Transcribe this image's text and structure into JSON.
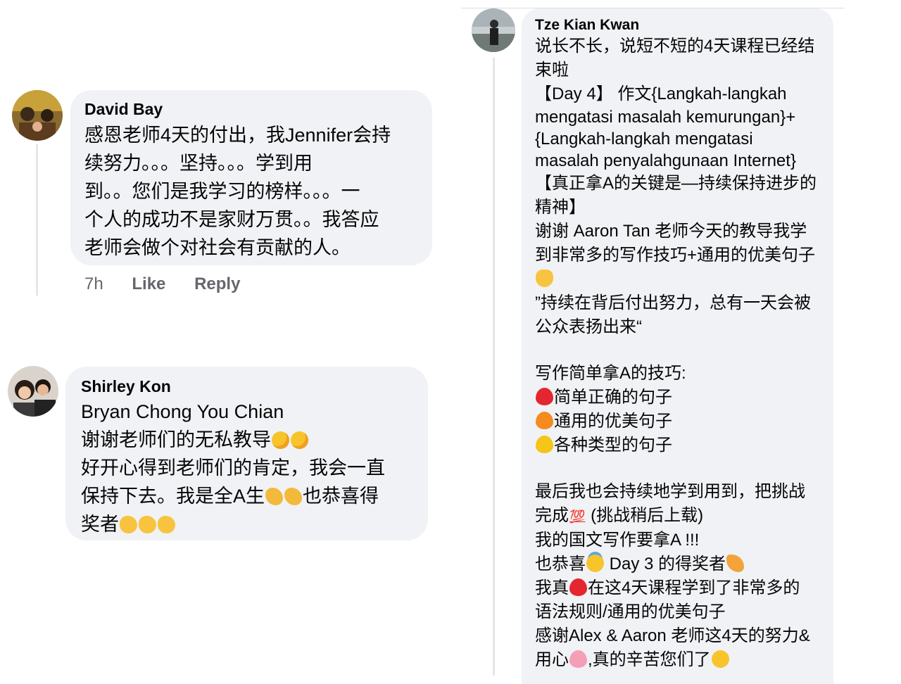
{
  "comments": {
    "david": {
      "name": "David Bay",
      "lines": [
        "感恩老师4天的付出，我Jennifer会持",
        "续努力。。。坚持。。。学到用",
        "到。。您们是我学习的榜样。。。一",
        "个人的成功不是家财万贯。。我答应",
        "老师会做个对社会有贡献的人。"
      ],
      "time": "7h",
      "like_label": "Like",
      "reply_label": "Reply"
    },
    "shirley": {
      "name": "Shirley Kon",
      "line1": "Bryan Chong You Chian",
      "line2": "谢谢老师们的无私教导",
      "line3": "好开心得到老师们的肯定，我会一直",
      "line4a": "保持下去。我是全A生",
      "line4b": "也恭喜得",
      "line5": "奖者"
    },
    "tze": {
      "name": "Tze Kian Kwan",
      "l1": "说长不长，说短不短的4天课程已经结",
      "l2": "束啦",
      "l3": "【Day 4】 作文{Langkah-langkah",
      "l4": "mengatasi masalah kemurungan}+",
      "l5": "{Langkah-langkah mengatasi",
      "l6": "masalah penyalahgunaan Internet}",
      "l7": "【真正拿A的关键是—持续保持进步的",
      "l8": "精神】",
      "l9": "谢谢 Aaron Tan 老师今天的教导我学",
      "l10": "到非常多的写作技巧+通用的优美句子",
      "l11": "”持续在背后付出努力，总有一天会被",
      "l12": "公众表扬出来“",
      "l13": "写作简单拿A的技巧:",
      "l14": "简单正确的句子",
      "l15": "通用的优美句子",
      "l16": "各种类型的句子",
      "l17": "最后我也会持续地学到用到，把挑战",
      "l18a": "完成",
      "l18b": " (挑战稍后上载)",
      "l19": "我的国文写作要拿A !!!",
      "l20a": "也恭喜",
      "l20b": " Day 3 的得奖者",
      "l21a": "我真",
      "l21b": "在这4天课程学到了非常多的",
      "l22": "语法规则/通用的优美句子",
      "l23": "感谢Alex & Aaron 老师这4天的努力&",
      "l24a": "用心",
      "l24b": ",真的辛苦您们了"
    }
  },
  "emoji": {
    "hundred": "💯"
  }
}
